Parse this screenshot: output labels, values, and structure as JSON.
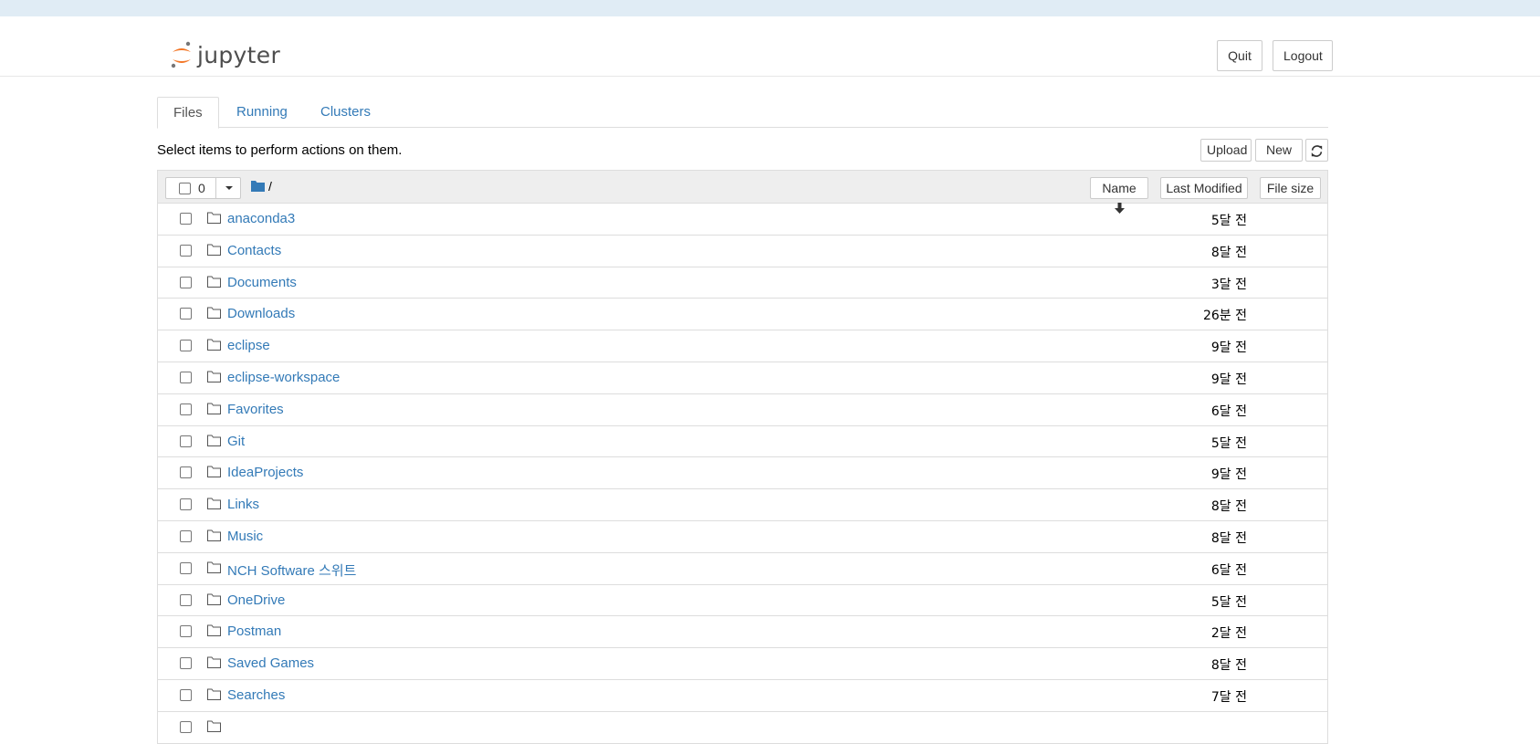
{
  "app": {
    "logo_text": "jupyter"
  },
  "header": {
    "quit_label": "Quit",
    "logout_label": "Logout"
  },
  "tabs": [
    {
      "label": "Files"
    },
    {
      "label": "Running"
    },
    {
      "label": "Clusters"
    }
  ],
  "toolbar": {
    "instruction": "Select items to perform actions on them.",
    "upload_label": "Upload",
    "new_label": "New"
  },
  "list_header": {
    "selected_count": "0",
    "path": "/",
    "sort_name_label": "Name",
    "last_modified_label": "Last Modified",
    "file_size_label": "File size"
  },
  "files": [
    {
      "name": "anaconda3",
      "modified": "5달 전"
    },
    {
      "name": "Contacts",
      "modified": "8달 전"
    },
    {
      "name": "Documents",
      "modified": "3달 전"
    },
    {
      "name": "Downloads",
      "modified": "26분 전"
    },
    {
      "name": "eclipse",
      "modified": "9달 전"
    },
    {
      "name": "eclipse-workspace",
      "modified": "9달 전"
    },
    {
      "name": "Favorites",
      "modified": "6달 전"
    },
    {
      "name": "Git",
      "modified": "5달 전"
    },
    {
      "name": "IdeaProjects",
      "modified": "9달 전"
    },
    {
      "name": "Links",
      "modified": "8달 전"
    },
    {
      "name": "Music",
      "modified": "8달 전"
    },
    {
      "name": "NCH Software 스위트",
      "modified": "6달 전"
    },
    {
      "name": "OneDrive",
      "modified": "5달 전"
    },
    {
      "name": "Postman",
      "modified": "2달 전"
    },
    {
      "name": "Saved Games",
      "modified": "8달 전"
    },
    {
      "name": "Searches",
      "modified": "7달 전"
    },
    {
      "name": "",
      "modified": ""
    }
  ],
  "colors": {
    "link": "#337ab7",
    "logo_orange": "#f37626",
    "logo_grey": "#767677"
  }
}
